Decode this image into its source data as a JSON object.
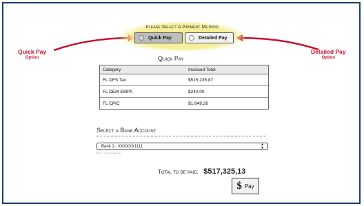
{
  "payment_method": {
    "title": "Please Select A Payment Method:",
    "options": [
      {
        "label": "Quick Pay",
        "selected": true
      },
      {
        "label": "Detailed Pay",
        "selected": false
      }
    ]
  },
  "callouts": {
    "left": {
      "title": "Quick Pay",
      "subtitle": "Option"
    },
    "right": {
      "title": "Detailed Pay",
      "subtitle": "Option"
    },
    "color": "#c8102e"
  },
  "quick_pay": {
    "title": "Quick Pay",
    "columns": [
      "Category",
      "Invoiced Total"
    ],
    "rows": [
      {
        "category": "FL DFS Tax",
        "total": "$515,235.87"
      },
      {
        "category": "FL DEM EMPA",
        "total": "$240.00"
      },
      {
        "category": "FL CPIC",
        "total": "$1,849.26"
      }
    ]
  },
  "bank": {
    "title": "Select a Bank Account",
    "selected": "Bank 1 - XXXXXX1111",
    "hint": "Select existing bank info"
  },
  "total": {
    "label": "Total to be paid:",
    "amount": "$517,325,13"
  },
  "pay_button": {
    "label": "Pay",
    "icon": "dollar-icon"
  },
  "colors": {
    "frame": "#1c3d6e",
    "highlight": "#f6ef9a"
  }
}
